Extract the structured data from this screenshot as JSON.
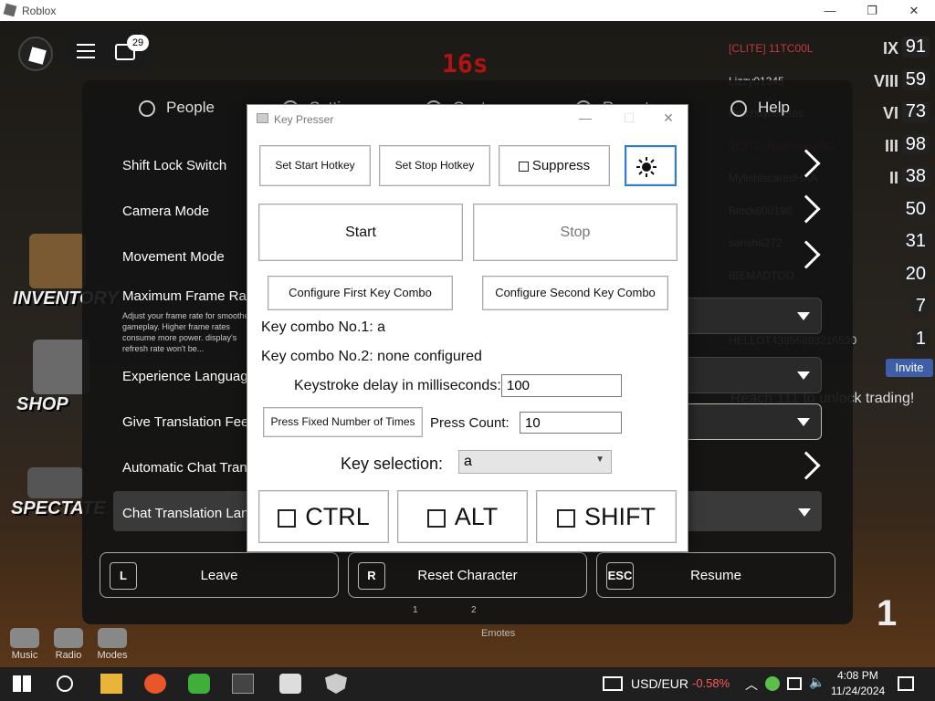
{
  "window": {
    "title": "Roblox"
  },
  "hud": {
    "chat_badge": "29",
    "timer": "16s",
    "left_items": [
      "INVENTORY",
      "SHOP",
      "SPECTATE"
    ],
    "bottom_items": [
      {
        "label": "Music"
      },
      {
        "label": "Radio"
      },
      {
        "label": "Modes"
      }
    ],
    "emotes_label": "Emotes",
    "slot_numbers": [
      "1",
      "2"
    ],
    "big_number": "1"
  },
  "leaderboard": {
    "rows": [
      {
        "name": "[CLITE] 11TC00L",
        "rank": "IX",
        "value": "91",
        "name_color": "#c23a3a"
      },
      {
        "name": "Lizzy01345",
        "rank": "VIII",
        "value": "59",
        "name_color": "#cfcfcf"
      },
      {
        "name": "Petchuynuletas",
        "rank": "VI",
        "value": "73",
        "name_color": "#cfcfcf"
      },
      {
        "name": "[BLITZ] Nightmare821",
        "rank": "III",
        "value": "98",
        "name_color": "#c23a3a"
      },
      {
        "name": "MylishiscaredHAA",
        "rank": "II",
        "value": "38",
        "name_color": "#cfcfcf"
      },
      {
        "name": "Block800198",
        "rank": "",
        "value": "50",
        "name_color": "#cfcfcf"
      },
      {
        "name": "sarisha272",
        "rank": "",
        "value": "31",
        "name_color": "#cfcfcf"
      },
      {
        "name": "IBEMADTOO",
        "rank": "",
        "value": "20",
        "name_color": "#cfcfcf"
      },
      {
        "name": "",
        "rank": "",
        "value": "7",
        "name_color": "#cfcfcf"
      },
      {
        "name": "HELLOT43856893216530",
        "rank": "",
        "value": "1",
        "name_color": "#cfcfcf"
      }
    ],
    "invite_label": "Invite",
    "trade_text": "Reach 111 to unlock trading!"
  },
  "settings": {
    "tabs": [
      "People",
      "Settings",
      "Captures",
      "Report",
      "Help"
    ],
    "rows": [
      {
        "label": "Shift Lock Switch"
      },
      {
        "label": "Camera Mode"
      },
      {
        "label": "Movement Mode"
      },
      {
        "label": "Maximum Frame Rate"
      },
      {
        "label": "Experience Language"
      },
      {
        "label": "Give Translation Feedback"
      },
      {
        "label": "Automatic Chat Translation"
      },
      {
        "label": "Chat Translation Language"
      }
    ],
    "frame_rate_desc": "Adjust your frame rate for smoother gameplay. Higher frame rates consume more power. display's refresh rate won't be...",
    "buttons": [
      {
        "key": "L",
        "label": "Leave"
      },
      {
        "key": "R",
        "label": "Reset Character"
      },
      {
        "key": "ESC",
        "label": "Resume"
      }
    ]
  },
  "keypresser": {
    "title": "Key Presser",
    "set_start_hotkey": "Set Start Hotkey",
    "set_stop_hotkey": "Set Stop Hotkey",
    "suppress": "Suppress",
    "start": "Start",
    "stop": "Stop",
    "configure_first": "Configure First Key Combo",
    "configure_second": "Configure Second Key Combo",
    "combo1": "Key combo No.1: a",
    "combo2": "Key combo No.2: none configured",
    "delay_label": "Keystroke delay in milliseconds:",
    "delay_value": "100",
    "press_fixed": "Press Fixed Number of Times",
    "press_count_label": "Press Count:",
    "press_count_value": "10",
    "key_selection_label": "Key selection:",
    "key_selection_value": "a",
    "mods": [
      "CTRL",
      "ALT",
      "SHIFT"
    ]
  },
  "taskbar": {
    "currency": "USD/EUR",
    "change": "-0.58%",
    "change_color": "#ff5a5a",
    "time": "4:08 PM",
    "date": "11/24/2024"
  }
}
